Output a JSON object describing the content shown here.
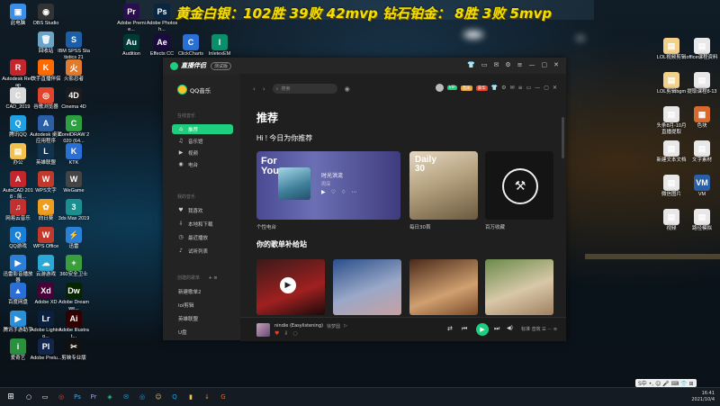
{
  "overlay": {
    "text": "黄金白银：102胜 39败 42mvp 钻石铂金： 8胜 3败 5mvp"
  },
  "desktop": {
    "left_icons": [
      {
        "label": "此电脑",
        "color": "#3a8ee6",
        "glyph": "▣"
      },
      {
        "label": "OBS Studio",
        "color": "#333",
        "glyph": "◉"
      },
      {
        "label": "Adobe Premie...",
        "color": "#2a0e4d",
        "glyph": "Pr"
      },
      {
        "label": "Adobe Photosh...",
        "color": "#0a2540",
        "glyph": "Ps"
      },
      {
        "label": "回收站",
        "color": "#6aa5c9",
        "glyph": "🗑"
      },
      {
        "label": "IBM SPSS Statistics 21",
        "color": "#1a5fa8",
        "glyph": "S"
      },
      {
        "label": "Autodesk ReCap",
        "color": "#c4262e",
        "glyph": "R"
      },
      {
        "label": "快手直播伴侣",
        "color": "#ff6a00",
        "glyph": "K"
      },
      {
        "label": "火影忍者",
        "color": "#e07a2e",
        "glyph": "火"
      },
      {
        "label": "CAD_2019",
        "color": "#d9d9d9",
        "glyph": "C"
      },
      {
        "label": "谷歌浏览器",
        "color": "#e0452c",
        "glyph": "◎"
      },
      {
        "label": "Cinema 4D",
        "color": "#1c1c1c",
        "glyph": "4D"
      },
      {
        "label": "腾讯QQ",
        "color": "#1ea0e5",
        "glyph": "Q"
      },
      {
        "label": "Autodesk 桌面应用程序",
        "color": "#2a5fa8",
        "glyph": "A"
      },
      {
        "label": "CorelDRAW 2020 (64...",
        "color": "#2c9f3e",
        "glyph": "C"
      },
      {
        "label": "办公",
        "color": "#f2c14e",
        "glyph": "▤"
      },
      {
        "label": "英雄联盟",
        "color": "#11324f",
        "glyph": "L"
      },
      {
        "label": "KTK",
        "color": "#2a6fd6",
        "glyph": "K"
      },
      {
        "label": "AutoCAD 2018 - 简...",
        "color": "#c4262e",
        "glyph": "A"
      },
      {
        "label": "WPS文字",
        "color": "#c0392b",
        "glyph": "W"
      },
      {
        "label": "WeGame",
        "color": "#444",
        "glyph": "W"
      },
      {
        "label": "网易云音乐",
        "color": "#c2302f",
        "glyph": "♫"
      },
      {
        "label": "向日葵",
        "color": "#f09c1c",
        "glyph": "✿"
      },
      {
        "label": "3ds Max 2019",
        "color": "#1a8f8f",
        "glyph": "3"
      },
      {
        "label": "QQ游戏",
        "color": "#1a7fd6",
        "glyph": "Q"
      },
      {
        "label": "WPS Office",
        "color": "#c0392b",
        "glyph": "W"
      },
      {
        "label": "迅雷",
        "color": "#2a7fd6",
        "glyph": "⚡"
      },
      {
        "label": "迅雷影音播放器",
        "color": "#2a7fd6",
        "glyph": "▶"
      },
      {
        "label": "云游游戏",
        "color": "#2aa8d6",
        "glyph": "☁"
      },
      {
        "label": "360安全卫士",
        "color": "#3a9e3a",
        "glyph": "+"
      },
      {
        "label": "百度网盘",
        "color": "#2a6fd6",
        "glyph": "▲"
      },
      {
        "label": "Adobe XD",
        "color": "#470137",
        "glyph": "Xd"
      },
      {
        "label": "Adobe Dreamwe...",
        "color": "#072401",
        "glyph": "Dw"
      },
      {
        "label": "腾讯手游助手",
        "color": "#2a8fd6",
        "glyph": "▶"
      },
      {
        "label": "Adobe Lightroo...",
        "color": "#0a1f3d",
        "glyph": "Lr"
      },
      {
        "label": "Adobe Illustrat...",
        "color": "#330000",
        "glyph": "Ai"
      },
      {
        "label": "爱奇艺",
        "color": "#2a8f3e",
        "glyph": "i"
      },
      {
        "label": "Adobe Prelu...",
        "color": "#12254a",
        "glyph": "Pl"
      },
      {
        "label": "剪映专业版",
        "color": "#111",
        "glyph": "✂"
      },
      {
        "label": "Audition",
        "color": "#003a36",
        "glyph": "Au"
      },
      {
        "label": "Effects CC",
        "color": "#1a0a3d",
        "glyph": "Ae"
      },
      {
        "label": "ClickCharts",
        "color": "#2a6fd6",
        "glyph": "C"
      },
      {
        "label": "InletexEM",
        "color": "#0a8f6a",
        "glyph": "I"
      }
    ],
    "right_icons": [
      {
        "label": "LOL视频剪辑",
        "color": "#f2d28a",
        "glyph": "▤"
      },
      {
        "label": "office课程资料",
        "color": "#e8e8e8",
        "glyph": "▤"
      },
      {
        "label": "LOL剪辑bgm",
        "color": "#f2d28a",
        "glyph": "▤"
      },
      {
        "label": "提取课程8-13",
        "color": "#e8e8e8",
        "glyph": "▤"
      },
      {
        "label": "头条8月-10月直播提取",
        "color": "#e8e8e8",
        "glyph": "▤"
      },
      {
        "label": "色块",
        "color": "#d86a2e",
        "glyph": "▦"
      },
      {
        "label": "新建文本文档",
        "color": "#e8e8e8",
        "glyph": "▤"
      },
      {
        "label": "文字素材",
        "color": "#e8e8e8",
        "glyph": "▤"
      },
      {
        "label": "微信图片",
        "color": "#e8e8e8",
        "glyph": "▤"
      },
      {
        "label": "VM",
        "color": "#2a5fa8",
        "glyph": "VM"
      },
      {
        "label": "视频",
        "color": "#e8e8e8",
        "glyph": "▤"
      },
      {
        "label": "路径模拟",
        "color": "#e8e8e8",
        "glyph": "▤"
      }
    ]
  },
  "window": {
    "app_name": "直播伴侣",
    "version_tag": "测试版",
    "titlebar_icons": [
      "shirt-icon",
      "chat-icon",
      "message-icon",
      "settings-icon",
      "menu-icon",
      "minimize-icon",
      "maximize-icon",
      "close-icon"
    ],
    "sidebar": {
      "brand": "QQ音乐",
      "section_online": "在线音乐",
      "items_online": [
        {
          "icon": "⌂",
          "label": "推荐",
          "active": true
        },
        {
          "icon": "♫",
          "label": "音乐馆",
          "active": false
        },
        {
          "icon": "▶",
          "label": "视频",
          "active": false
        },
        {
          "icon": "◉",
          "label": "电台",
          "active": false
        }
      ],
      "section_my": "我的音乐",
      "items_my": [
        {
          "icon": "♥",
          "label": "我喜欢"
        },
        {
          "icon": "⇩",
          "label": "本地和下载"
        },
        {
          "icon": "◷",
          "label": "最近播放"
        },
        {
          "icon": "♪",
          "label": "试听列表"
        }
      ],
      "section_created": "创建的歌单",
      "created_actions": "+ ≡",
      "playlists": [
        "新建歌单2",
        "lol剪辑",
        "英雄联盟",
        "U盘"
      ]
    },
    "topbar": {
      "back": "‹",
      "forward": "›",
      "refresh": "↻",
      "search_placeholder": "搜索",
      "mic_icon": "◉",
      "badges": [
        "VIP",
        "音乐",
        "豪华"
      ]
    },
    "main": {
      "title": "推荐",
      "greeting": "Hi ! 今日为你推荐",
      "daily_card": {
        "title": "For You",
        "song": "时光洪流",
        "artist": "周深",
        "controls": [
          "▶",
          "♡",
          "♢",
          "⋯"
        ]
      },
      "tiles": [
        {
          "caption": "个性电台",
          "label": ""
        },
        {
          "caption": "每日30首",
          "label": "Daily 30"
        },
        {
          "caption": "百万收藏",
          "label": ""
        }
      ],
      "section2_title": "你的歌单补给站",
      "playlist_covers": [
        {
          "colors": [
            "#3a1a1a",
            "#a02020"
          ]
        },
        {
          "colors": [
            "#2a4f8a",
            "#c8a0a0"
          ]
        },
        {
          "colors": [
            "#4a2a1a",
            "#d0a070"
          ]
        },
        {
          "colors": [
            "#6a8a4a",
            "#d8c8a8"
          ]
        }
      ]
    },
    "player": {
      "song": "nindie (Easylistening)",
      "artist": "徐梦圆",
      "mv_tag": "▷",
      "controls": {
        "prev": "⏮",
        "play": "▶",
        "next": "⏭",
        "mode": "⇄",
        "volume": "◀)"
      },
      "extra": "标准  音效  ☰  ⋯  ≡"
    }
  },
  "taskbar": {
    "start": "⊞",
    "items": [
      "○",
      "▭",
      "◎",
      "Ps",
      "Pr",
      "◈",
      "✉",
      "◎",
      "☺",
      "Q",
      "▮",
      "↓",
      "G"
    ],
    "item_colors": [
      "#fff",
      "#fff",
      "#e0452c",
      "#31a8ff",
      "#9999ff",
      "#1ecd7e",
      "#2a9fd6",
      "#1ea0e5",
      "#f2c14e",
      "#1ea0e5",
      "#f2c14e",
      "#f28a2e",
      "#e06a2e"
    ],
    "time": "16:41",
    "date": "2021/10/4"
  },
  "ime": {
    "label": "S中 •, ☺ 🎤 ⌨ 👕 ⊞"
  }
}
